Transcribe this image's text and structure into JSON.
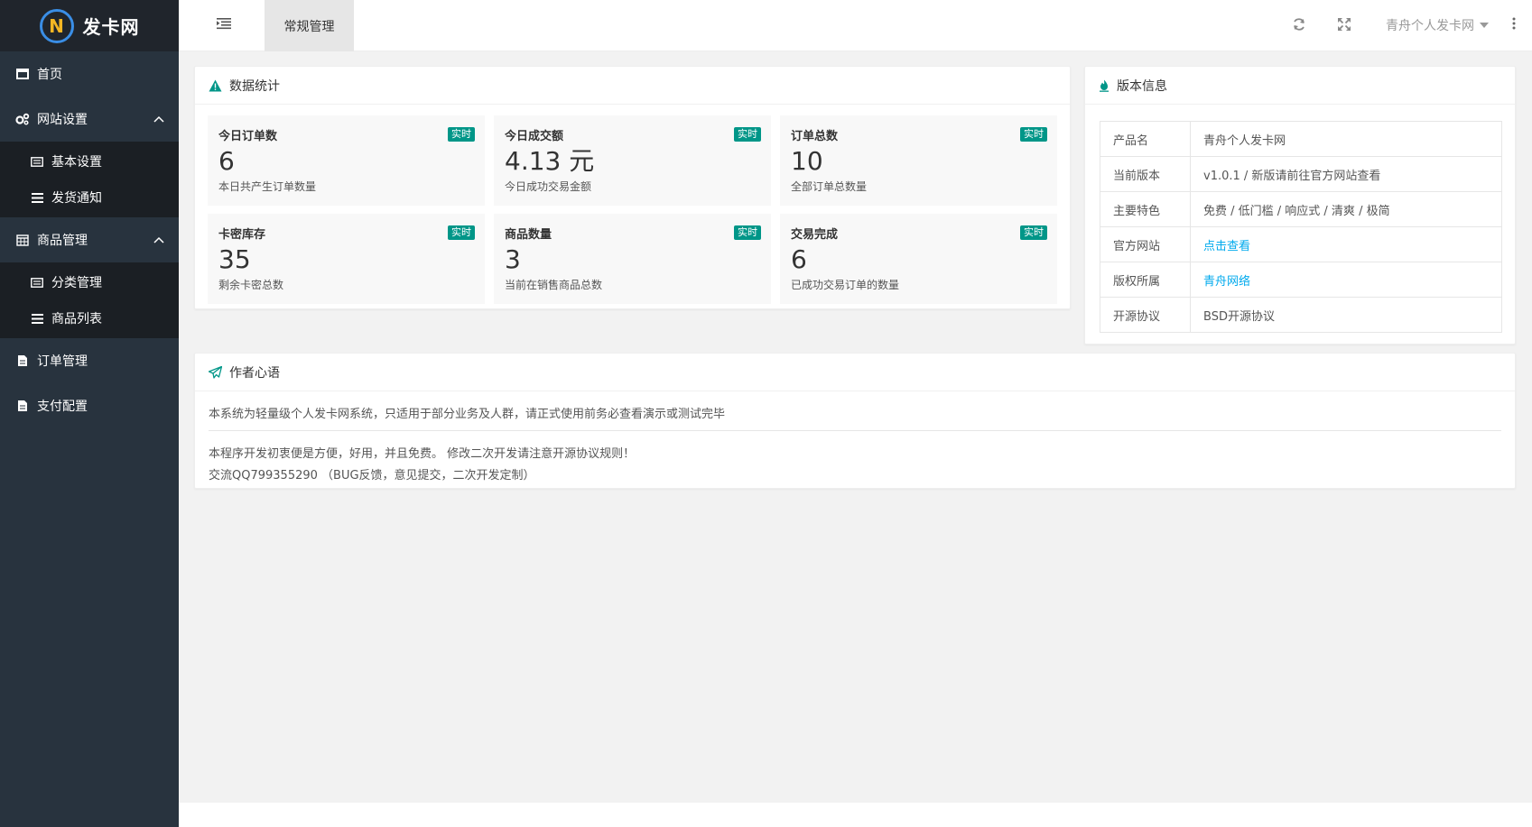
{
  "brand": {
    "logo_letter": "N",
    "name": "发卡网"
  },
  "sidebar": {
    "items": [
      {
        "label": "首页",
        "icon": "window-icon"
      },
      {
        "label": "网站设置",
        "icon": "gears-icon",
        "expanded": true,
        "children": [
          {
            "label": "基本设置",
            "icon": "list-alt-icon"
          },
          {
            "label": "发货通知",
            "icon": "bars-icon"
          }
        ]
      },
      {
        "label": "商品管理",
        "icon": "calendar-icon",
        "expanded": true,
        "children": [
          {
            "label": "分类管理",
            "icon": "list-alt-icon"
          },
          {
            "label": "商品列表",
            "icon": "bars-icon"
          }
        ]
      },
      {
        "label": "订单管理",
        "icon": "file-icon"
      },
      {
        "label": "支付配置",
        "icon": "file-icon"
      }
    ]
  },
  "header": {
    "tab_label": "常规管理",
    "user_label": "青舟个人发卡网"
  },
  "stats": {
    "title": "数据统计",
    "badge": "实时",
    "items": [
      {
        "label": "今日订单数",
        "value": "6",
        "desc": "本日共产生订单数量"
      },
      {
        "label": "今日成交额",
        "value": "4.13 元",
        "desc": "今日成功交易金额"
      },
      {
        "label": "订单总数",
        "value": "10",
        "desc": "全部订单总数量"
      },
      {
        "label": "卡密库存",
        "value": "35",
        "desc": "剩余卡密总数"
      },
      {
        "label": "商品数量",
        "value": "3",
        "desc": "当前在销售商品总数"
      },
      {
        "label": "交易完成",
        "value": "6",
        "desc": "已成功交易订单的数量"
      }
    ]
  },
  "version": {
    "title": "版本信息",
    "rows": [
      {
        "key": "产品名",
        "value": "青舟个人发卡网"
      },
      {
        "key": "当前版本",
        "value": "v1.0.1 / 新版请前往官方网站查看"
      },
      {
        "key": "主要特色",
        "value": "免费 / 低门槛 / 响应式 / 清爽 / 极简"
      },
      {
        "key": "官方网站",
        "value": "点击查看",
        "link": true
      },
      {
        "key": "版权所属",
        "value": "青舟网络",
        "link": true
      },
      {
        "key": "开源协议",
        "value": "BSD开源协议"
      }
    ]
  },
  "notes": {
    "title": "作者心语",
    "line1": "本系统为轻量级个人发卡网系统，只适用于部分业务及人群，请正式使用前务必查看演示或测试完毕",
    "line2": "本程序开发初衷便是方便，好用，并且免费。 修改二次开发请注意开源协议规则！",
    "line3": "交流QQ799355290 （BUG反馈，意见提交，二次开发定制）"
  },
  "colors": {
    "accent": "#009688",
    "link": "#01aaed",
    "sidebar": "#28333e"
  }
}
